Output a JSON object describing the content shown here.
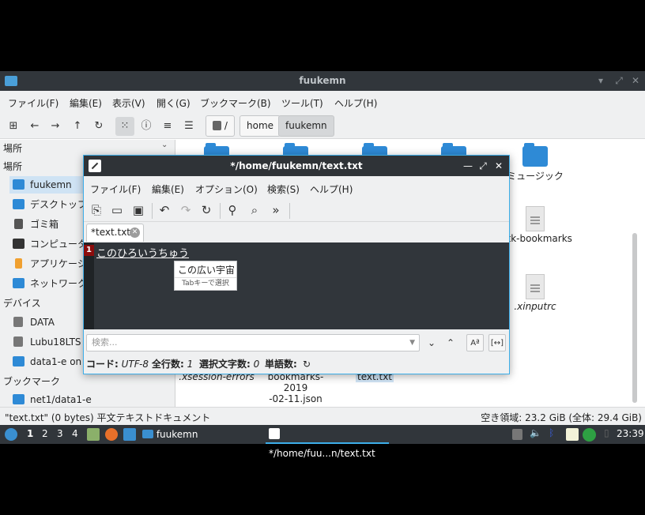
{
  "file_manager": {
    "title": "fuukemn",
    "menu": [
      "ファイル(F)",
      "編集(E)",
      "表示(V)",
      "開く(G)",
      "ブックマーク(B)",
      "ツール(T)",
      "ヘルプ(H)"
    ],
    "path": {
      "root": "/",
      "segments": [
        "home",
        "fuukemn"
      ]
    },
    "sidebar": {
      "heading_places": "場所",
      "section_places": "場所",
      "places": [
        "fuukemn",
        "デスクトップ",
        "ゴミ箱",
        "コンピュータ",
        "アプリケーション",
        "ネットワーク"
      ],
      "section_devices": "デバイス",
      "devices": [
        "DATA",
        "Lubu18LTS",
        "data1-e on n"
      ],
      "section_bookmarks": "ブックマーク",
      "bookmarks": [
        "net1/data1-e"
      ]
    },
    "files": {
      "music": "ミュージック",
      "gtk_bookmarks": ".gtk-bookmarks",
      "xinputrc": ".xinputrc",
      "xsession_errors": ".xsession-errors",
      "bookmarks_json_1": "bookmarks-2019",
      "bookmarks_json_2": "-02-11.json",
      "text_txt": "text.txt"
    },
    "status_left": "\"text.txt\" (0 bytes) 平文テキストドキュメント",
    "status_right": "空き領域: 23.2 GiB (全体: 29.4 GiB)"
  },
  "editor": {
    "title": "*/home/fuukemn/text.txt",
    "menu": [
      "ファイル(F)",
      "編集(E)",
      "オプション(O)",
      "検索(S)",
      "ヘルプ(H)"
    ],
    "tab_label": "*text.txt",
    "line_number": "1",
    "line1_text": "このひろいうちゅう",
    "ime_candidate": "この広い宇宙",
    "ime_hint": "Tabキーで選択",
    "search_placeholder": "検索...",
    "case_button": "Aª",
    "whole_word_button": "[↔]",
    "status": {
      "encoding_label": "コード:",
      "encoding_value": "UTF-8",
      "lines_label": "全行数:",
      "lines_value": "1",
      "selected_label": "選択文字数:",
      "selected_value": "0",
      "words_label": "単語数:"
    }
  },
  "taskbar": {
    "workspaces": [
      "1",
      "2",
      "3",
      "4"
    ],
    "file_manager_task": "fuukemn",
    "editor_task": "*/home/fuu...n/text.txt",
    "clock": "23:39"
  }
}
